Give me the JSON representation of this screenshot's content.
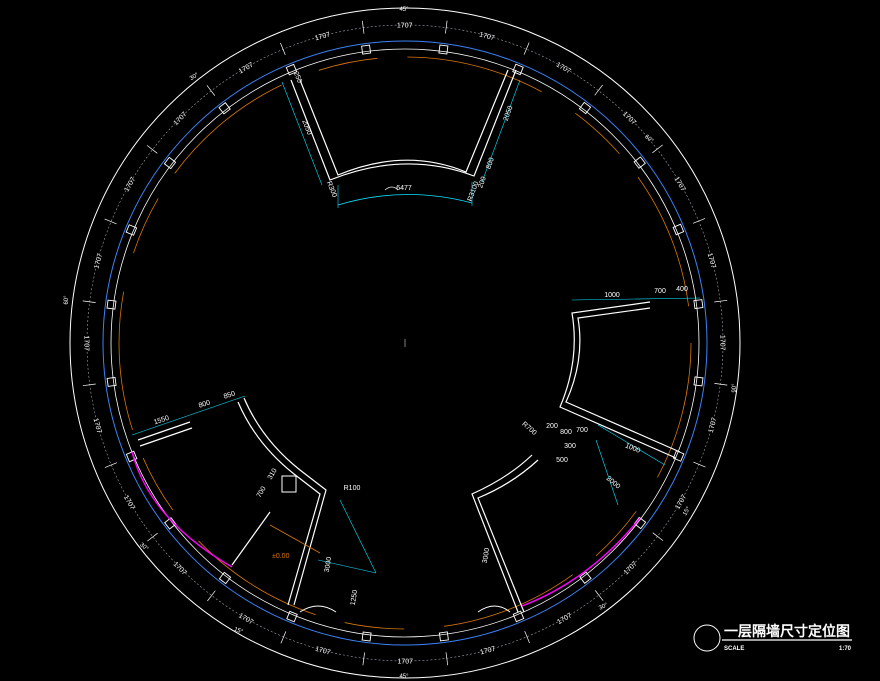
{
  "title": {
    "main": "一层隔墙尺寸定位图",
    "scale_label": "SCALE",
    "scale_value": "1:70"
  },
  "colors": {
    "background": "#000000",
    "wall": "#ffffff",
    "dimension": "#00e5ff",
    "inner_ring": "#3b82f6",
    "orange_ring": "#d97706",
    "highlight": "#ff00ff"
  },
  "ring_dims": {
    "segment_label": "1707",
    "angle_45": "45°",
    "angle_30": "30°",
    "angle_60": "60°",
    "angle_90": "90°",
    "angle_15": "15°"
  },
  "top_room": {
    "arc_label": "6477",
    "side_left_a": "2050",
    "side_left_b": "250",
    "side_left_c": "R300",
    "side_right_a": "2050",
    "side_right_b": "800",
    "side_right_c": "200",
    "side_right_d": "R3100"
  },
  "right_room": {
    "top_a": "1000",
    "top_b": "700",
    "top_c": "400",
    "bottom_a": "1000",
    "bottom_b": "2000",
    "bottom_c": "700",
    "bottom_d": "800",
    "bottom_e": "200",
    "bottom_f": "R700",
    "bottom_g": "300",
    "bottom_h": "500"
  },
  "left_room": {
    "top_a": "1550",
    "top_b": "800",
    "top_c": "850",
    "inner_a": "700",
    "inner_b": "310",
    "radius": "R100",
    "long_a": "3000",
    "long_b": "1250",
    "level": "±0.00"
  },
  "bottom_right_room": {
    "long_a": "3000"
  }
}
